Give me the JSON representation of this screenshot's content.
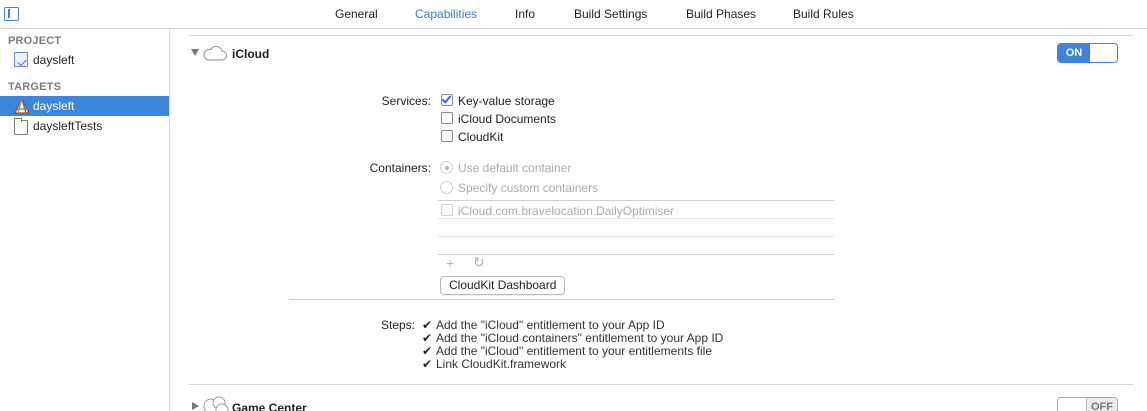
{
  "tabs": [
    {
      "label": "General",
      "active": false
    },
    {
      "label": "Capabilities",
      "active": true
    },
    {
      "label": "Info",
      "active": false
    },
    {
      "label": "Build Settings",
      "active": false
    },
    {
      "label": "Build Phases",
      "active": false
    },
    {
      "label": "Build Rules",
      "active": false
    }
  ],
  "sidebar": {
    "project_header": "PROJECT",
    "project_item": "daysleft",
    "targets_header": "TARGETS",
    "targets": [
      {
        "label": "daysleft",
        "selected": true,
        "icon": "app-target-icon"
      },
      {
        "label": "daysleftTests",
        "selected": false,
        "icon": "test-bundle-icon"
      }
    ]
  },
  "icloud": {
    "title": "iCloud",
    "toggle_label": "ON",
    "services_label": "Services:",
    "services": [
      {
        "label": "Key-value storage",
        "checked": true
      },
      {
        "label": "iCloud Documents",
        "checked": false
      },
      {
        "label": "CloudKit",
        "checked": false
      }
    ],
    "containers_label": "Containers:",
    "container_options": [
      {
        "label": "Use default container",
        "selected": true
      },
      {
        "label": "Specify custom containers",
        "selected": false
      }
    ],
    "container_list": [
      {
        "label": "iCloud.com.bravelocation.DailyOptimiser",
        "checked": false
      }
    ],
    "add_symbol": "+",
    "refresh_symbol": "↻",
    "dashboard_button": "CloudKit Dashboard",
    "steps_label": "Steps:",
    "check_symbol": "✔",
    "steps": [
      "Add the \"iCloud\" entitlement to your App ID",
      "Add the \"iCloud containers\" entitlement to your App ID",
      "Add the \"iCloud\" entitlement to your entitlements file",
      "Link CloudKit.framework"
    ]
  },
  "game_center": {
    "title": "Game Center",
    "toggle_label": "OFF"
  },
  "colors": {
    "accent": "#3a84df",
    "selection": "#3d86dd"
  }
}
